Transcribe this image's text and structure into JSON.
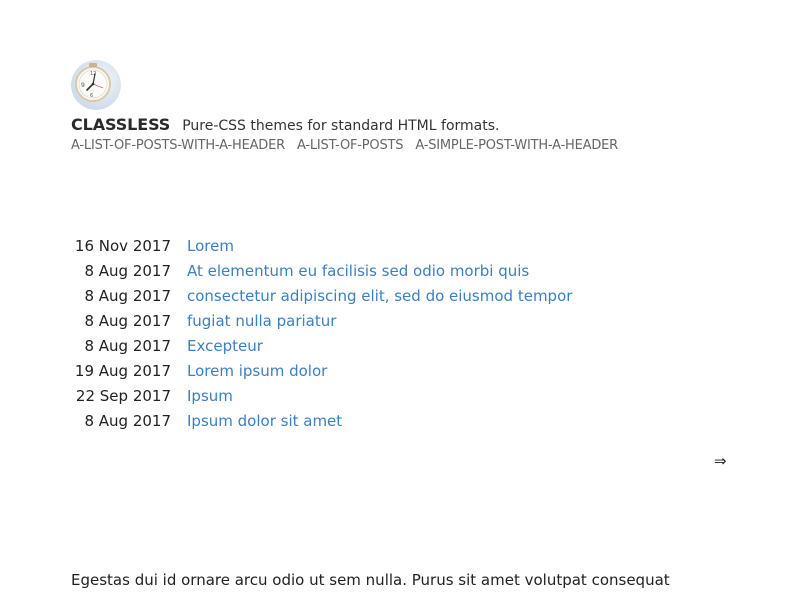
{
  "site": {
    "title": "CLASSLESS",
    "tagline": "Pure-CSS themes for standard HTML formats."
  },
  "nav": {
    "items": [
      {
        "label": "A-LIST-OF-POSTS-WITH-A-HEADER"
      },
      {
        "label": "A-LIST-OF-POSTS"
      },
      {
        "label": "A-SIMPLE-POST-WITH-A-HEADER"
      }
    ]
  },
  "posts": [
    {
      "date": "16 Nov 2017",
      "title": "Lorem"
    },
    {
      "date": "8 Aug 2017",
      "title": "At elementum eu facilisis sed odio morbi quis"
    },
    {
      "date": "8 Aug 2017",
      "title": "consectetur adipiscing elit, sed do eiusmod tempor"
    },
    {
      "date": "8 Aug 2017",
      "title": "fugiat nulla pariatur"
    },
    {
      "date": "8 Aug 2017",
      "title": "Excepteur"
    },
    {
      "date": "19 Aug 2017",
      "title": "Lorem ipsum dolor"
    },
    {
      "date": "22 Sep 2017",
      "title": "Ipsum"
    },
    {
      "date": "8 Aug 2017",
      "title": "Ipsum dolor sit amet"
    }
  ],
  "pager": {
    "next_label": "⇒"
  },
  "content": {
    "excerpt": "Egestas dui id ornare arcu odio ut sem nulla. Purus sit amet volutpat consequat"
  },
  "icons": {
    "avatar": "clock-avatar-icon"
  },
  "colors": {
    "link": "#3b7fc4",
    "nav": "#666666",
    "text": "#222222"
  }
}
